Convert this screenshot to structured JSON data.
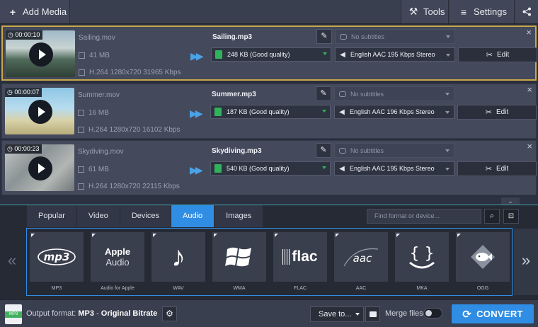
{
  "toolbar": {
    "add_media": "Add Media",
    "tools": "Tools",
    "settings": "Settings"
  },
  "files": [
    {
      "duration": "00:00:10",
      "name": "Sailing.mov",
      "size": "41 MB",
      "codec": "H.264 1280x720 31965 Kbps",
      "output_name": "Sailing.mp3",
      "quality": "248 KB (Good quality)",
      "subtitles": "No subtitles",
      "audio": "English AAC 195 Kbps Stereo",
      "edit": "Edit",
      "selected": true
    },
    {
      "duration": "00:00:07",
      "name": "Summer.mov",
      "size": "16 MB",
      "codec": "H.264 1280x720 16102 Kbps",
      "output_name": "Summer.mp3",
      "quality": "187 KB (Good quality)",
      "subtitles": "No subtitles",
      "audio": "English AAC 196 Kbps Stereo",
      "edit": "Edit",
      "selected": false
    },
    {
      "duration": "00:00:23",
      "name": "Skydiving.mov",
      "size": "61 MB",
      "codec": "H.264 1280x720 22115 Kbps",
      "output_name": "Skydiving.mp3",
      "quality": "540 KB (Good quality)",
      "subtitles": "No subtitles",
      "audio": "English AAC 195 Kbps Stereo",
      "edit": "Edit",
      "selected": false
    }
  ],
  "format_panel": {
    "tabs": [
      "Popular",
      "Video",
      "Devices",
      "Audio",
      "Images"
    ],
    "active_tab": "Audio",
    "search_placeholder": "Find format or device...",
    "formats": [
      {
        "label": "MP3",
        "icon": "mp3-logo"
      },
      {
        "label": "Audio for Apple",
        "icon": "apple-audio-logo",
        "tile_line1": "Apple",
        "tile_line2": "Audio"
      },
      {
        "label": "WAV",
        "icon": "music-note-icon"
      },
      {
        "label": "WMA",
        "icon": "windows-logo-icon"
      },
      {
        "label": "FLAC",
        "icon": "flac-logo",
        "tile_text": "flac"
      },
      {
        "label": "AAC",
        "icon": "aac-logo",
        "tile_text": "aac"
      },
      {
        "label": "MKA",
        "icon": "mka-logo"
      },
      {
        "label": "OGG",
        "icon": "ogg-fish-logo"
      }
    ]
  },
  "bottom": {
    "output_format_label": "Output format:",
    "output_format_value": "MP3",
    "output_format_dash": "-",
    "output_format_preset": "Original Bitrate",
    "output_icon_text": "MP3",
    "save_to": "Save to...",
    "merge_files": "Merge files:",
    "convert": "CONVERT"
  },
  "colors": {
    "accent": "#2f8de4",
    "selected_border": "#c8a84a",
    "file_green": "#30b25a",
    "background": "#2b3140"
  }
}
